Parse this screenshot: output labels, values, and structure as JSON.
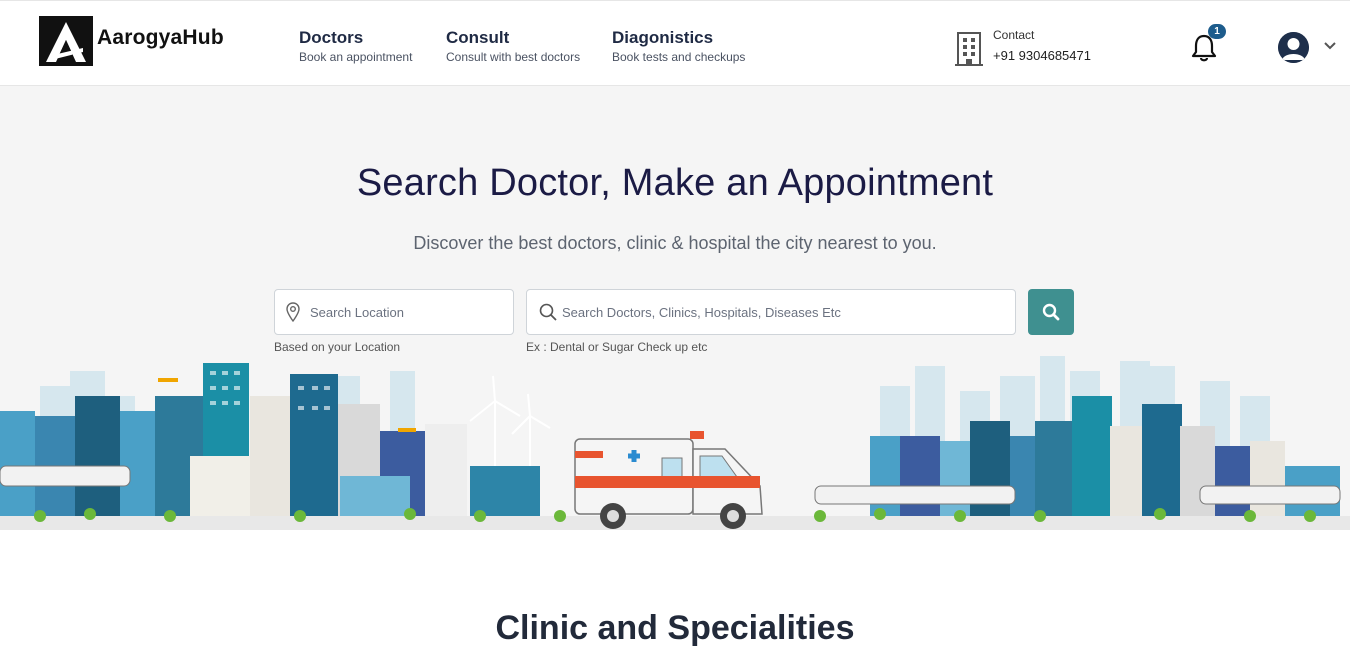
{
  "brand": {
    "name": "AarogyaHub"
  },
  "nav": [
    {
      "title": "Doctors",
      "subtitle": "Book an appointment"
    },
    {
      "title": "Consult",
      "subtitle": "Consult with best doctors"
    },
    {
      "title": "Diagonistics",
      "subtitle": "Book tests and checkups"
    }
  ],
  "contact": {
    "label": "Contact",
    "phone": "+91 9304685471",
    "icon": "building-icon"
  },
  "notifications": {
    "count": "1",
    "icon": "bell-icon"
  },
  "user": {
    "icon": "user-avatar-icon"
  },
  "hero": {
    "title": "Search Doctor, Make an Appointment",
    "subtitle": "Discover the best doctors, clinic & hospital the city nearest to you.",
    "location_placeholder": "Search Location",
    "location_hint": "Based on your Location",
    "search_placeholder": "Search Doctors, Clinics, Hospitals, Diseases Etc",
    "search_hint": "Ex : Dental or Sugar Check up etc"
  },
  "section": {
    "title": "Clinic and Specialities"
  },
  "colors": {
    "accent": "#3f9090",
    "heading": "#1b1b45",
    "badge": "#1d5c8c"
  }
}
